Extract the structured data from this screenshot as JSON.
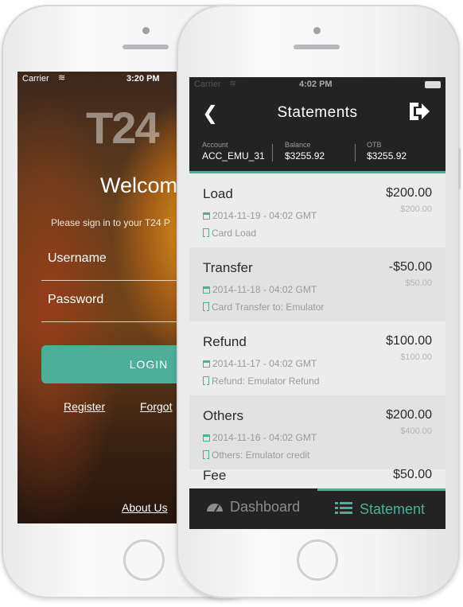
{
  "login_screen": {
    "status": {
      "carrier": "Carrier",
      "time": "3:20 PM"
    },
    "logo_text": "T24",
    "welcome": "Welcom",
    "signin_text": "Please sign in to your T24 P",
    "username_placeholder": "Username",
    "password_placeholder": "Password",
    "login_label": "LOGIN",
    "register_label": "Register",
    "forgot_label": "Forgot",
    "about_label": "About Us"
  },
  "statement_screen": {
    "status": {
      "carrier": "Carrier",
      "time": "4:02 PM"
    },
    "title": "Statements",
    "account": {
      "label": "Account",
      "value": "ACC_EMU_31"
    },
    "balance": {
      "label": "Balance",
      "value": "$3255.92"
    },
    "otb": {
      "label": "OTB",
      "value": "$3255.92"
    },
    "transactions": [
      {
        "type": "Load",
        "amount": "$200.00",
        "balance": "$200.00",
        "date": "2014-11-19 - 04:02 GMT",
        "desc": "Card Load"
      },
      {
        "type": "Transfer",
        "amount": "-$50.00",
        "balance": "$50.00",
        "date": "2014-11-18 - 04:02 GMT",
        "desc": "Card Transfer to: Emulator"
      },
      {
        "type": "Refund",
        "amount": "$100.00",
        "balance": "$100.00",
        "date": "2014-11-17 - 04:02 GMT",
        "desc": "Refund: Emulator Refund"
      },
      {
        "type": "Others",
        "amount": "$200.00",
        "balance": "$400.00",
        "date": "2014-11-16 - 04:02 GMT",
        "desc": "Others: Emulator credit"
      },
      {
        "type": "Fee",
        "amount": "$50.00",
        "balance": "",
        "date": "",
        "desc": ""
      }
    ],
    "tabs": {
      "dashboard": "Dashboard",
      "statement": "Statement"
    },
    "accent_color": "#4caf9a"
  }
}
